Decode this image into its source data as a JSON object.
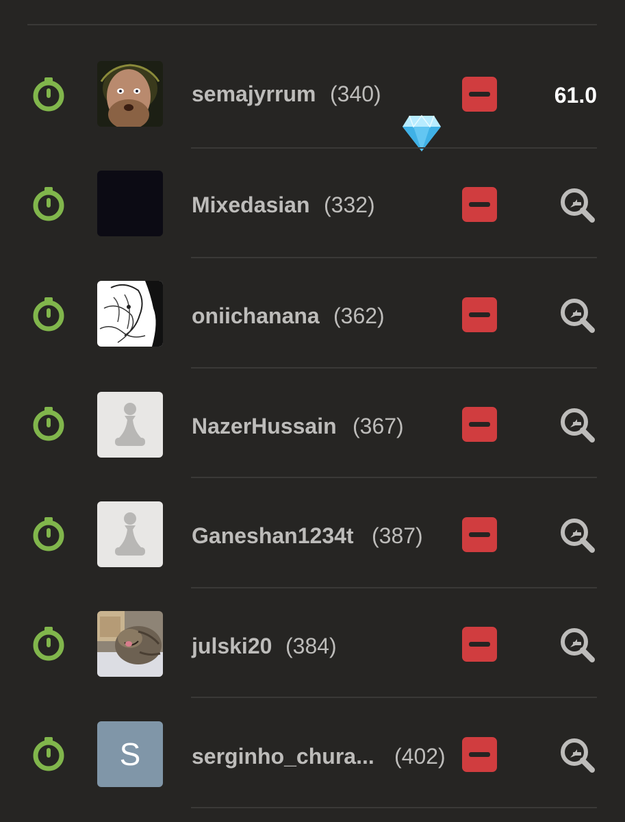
{
  "players": [
    {
      "username": "semajyrrum",
      "rating": "(340)",
      "avatar": "photo-bearded-man",
      "badge": "diamond-icon",
      "score": "61.0",
      "action_icon": null
    },
    {
      "username": "Mixedasian",
      "rating": "(332)",
      "avatar": "photo-dark",
      "badge": null,
      "score": null,
      "action_icon": "analyze-icon"
    },
    {
      "username": "oniichanana",
      "rating": "(362)",
      "avatar": "photo-anime-sketch",
      "badge": null,
      "score": null,
      "action_icon": "analyze-icon"
    },
    {
      "username": "NazerHussain",
      "rating": "(367)",
      "avatar": "default-pawn",
      "badge": null,
      "score": null,
      "action_icon": "analyze-icon"
    },
    {
      "username": "Ganeshan1234t",
      "rating": "(387)",
      "avatar": "default-pawn",
      "badge": null,
      "score": null,
      "action_icon": "analyze-icon"
    },
    {
      "username": "julski20",
      "rating": "(384)",
      "avatar": "photo-cat",
      "badge": null,
      "score": null,
      "action_icon": "analyze-icon"
    },
    {
      "username": "serginho_chura...",
      "rating": "(402)",
      "avatar": "letter",
      "avatar_letter": "S",
      "badge": null,
      "score": null,
      "action_icon": "analyze-icon"
    }
  ],
  "colors": {
    "background": "#262523",
    "clock_green": "#81b64c",
    "remove_red": "#d03d3f",
    "text_gray": "#bdbcba",
    "score_white": "#ffffff",
    "divider": "#3a3937",
    "letter_avatar_bg": "#8096a8"
  }
}
